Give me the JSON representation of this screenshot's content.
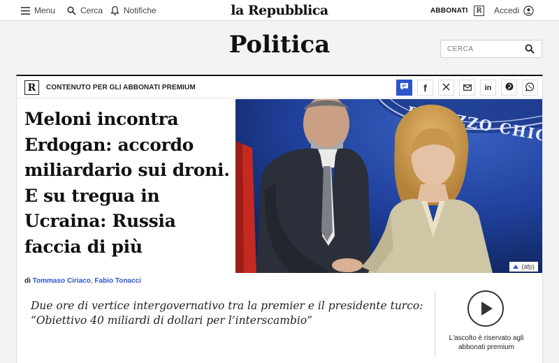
{
  "topbar": {
    "menu_label": "Menu",
    "search_label": "Cerca",
    "notifications_label": "Notifiche",
    "logo": "la Repubblica",
    "subscribe_label": "ABBONATI",
    "r_logo": "R",
    "login_label": "Accedi"
  },
  "section": {
    "title": "Politica",
    "search_placeholder": "CERCA"
  },
  "article": {
    "premium_label": "CONTENUTO PER GLI ABBONATI PREMIUM",
    "headline": "Meloni incontra Erdogan: accordo miliardario sui droni. E su tregua in Ucraina: Russia faccia di più",
    "photo_text": "PALAZZO CHIGI",
    "photo_credit": "(afp)",
    "byline_prefix": "di",
    "authors": [
      "Tommaso Ciriaco",
      "Fabio Tonacci"
    ],
    "summary": "Due ore di vertice intergovernativo tra la premier e il presidente turco: “Obiettivo 40 miliardi di dollari per l’interscambio”",
    "audio_notice": "L'ascolto è riservato agli abbonati premium"
  },
  "share_buttons": [
    {
      "name": "comment-icon",
      "glyph": "",
      "active": true
    },
    {
      "name": "facebook-icon",
      "glyph": "f",
      "active": false
    },
    {
      "name": "x-icon",
      "glyph": "𝕏",
      "active": false
    },
    {
      "name": "email-icon",
      "glyph": "",
      "active": false
    },
    {
      "name": "linkedin-icon",
      "glyph": "in",
      "active": false
    },
    {
      "name": "pinterest-icon",
      "glyph": "",
      "active": false
    },
    {
      "name": "whatsapp-icon",
      "glyph": "",
      "active": false
    }
  ],
  "colors": {
    "accent": "#2f55c9",
    "photo_background": "#1c3a8e"
  }
}
